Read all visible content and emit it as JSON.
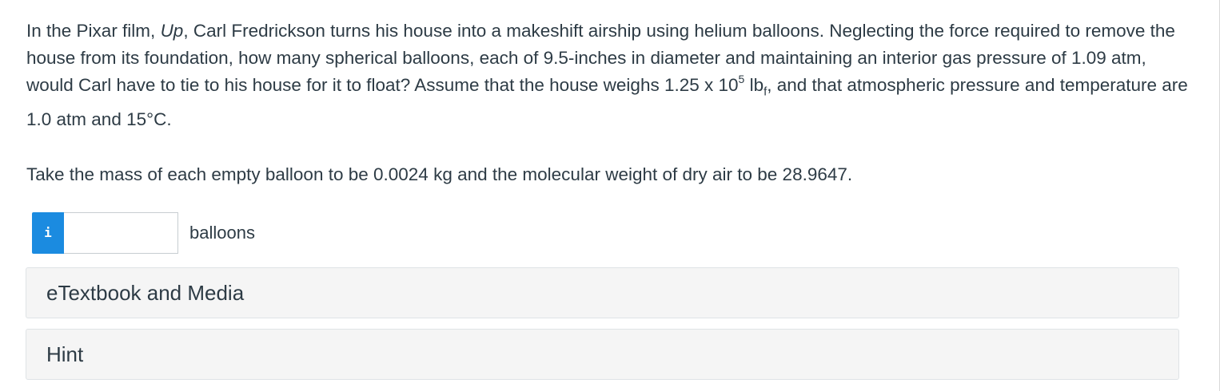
{
  "question": {
    "line1_a": "In the Pixar film, ",
    "film_title": "Up",
    "line1_b": ", Carl Fredrickson turns his house into a makeshift airship using helium balloons. Neglecting the force required to remove the house from its foundation, how many spherical balloons, each of 9.5-inches in diameter and maintaining an interior gas pressure of 1.09 atm, would Carl have to tie to his house for it to float? Assume that the house weighs 1.25 x 10",
    "exponent": "5",
    "line1_c": " lb",
    "unit_subscript": "f",
    "line1_d": ", and that atmospheric pressure and temperature are 1.0 atm and 15°C.",
    "paragraph2": "Take the mass of each empty balloon to be 0.0024 kg and the molecular weight of dry air to be 28.9647."
  },
  "answer": {
    "info_label": "i",
    "input_value": "",
    "unit": "balloons"
  },
  "panels": {
    "etextbook": "eTextbook and Media",
    "hint": "Hint"
  },
  "colors": {
    "info_badge": "#1b8be0",
    "panel_background": "#f5f5f5",
    "text": "#2d3b45"
  }
}
